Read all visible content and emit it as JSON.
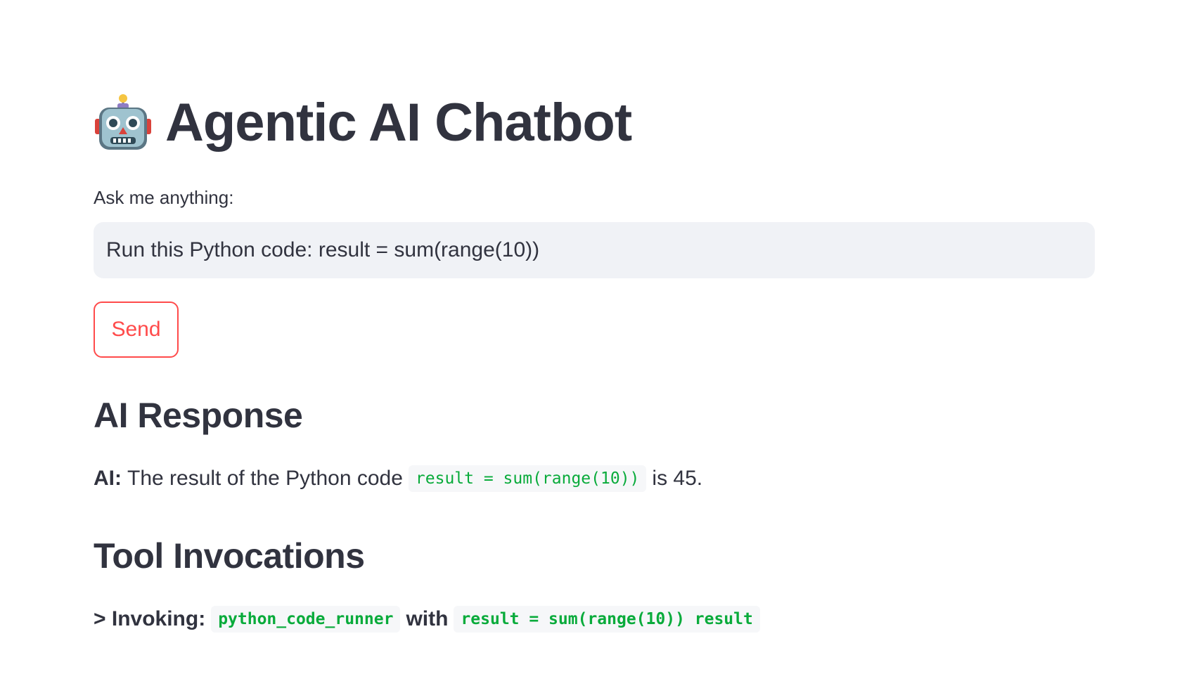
{
  "app": {
    "title_icon": "robot-icon",
    "title": "Agentic AI Chatbot"
  },
  "form": {
    "label": "Ask me anything:",
    "input_value": "Run this Python code: result = sum(range(10))",
    "send_label": "Send"
  },
  "response": {
    "heading": "AI Response",
    "speaker": "AI:",
    "text_before": "The result of the Python code",
    "code": "result = sum(range(10))",
    "text_after": "is 45."
  },
  "tools": {
    "heading": "Tool Invocations",
    "prefix": "> Invoking:",
    "tool_name": "python_code_runner",
    "connector": "with",
    "tool_args": "result = sum(range(10)) result"
  },
  "colors": {
    "accent": "#ff4b4b",
    "code_green": "#09ab3b",
    "input_bg": "#f0f2f6",
    "text": "#31333f"
  }
}
